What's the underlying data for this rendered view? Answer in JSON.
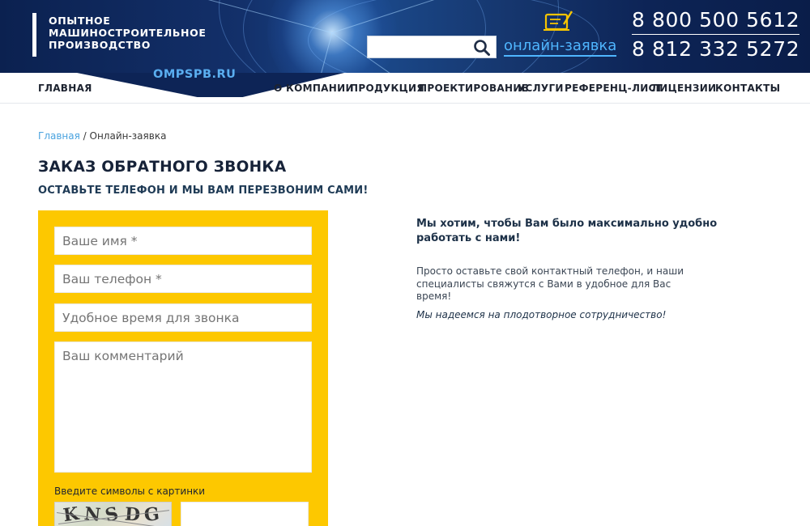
{
  "header": {
    "logo_lines": [
      "ОПЫТНОЕ",
      "МАШИНОСТРОИТЕЛЬНОЕ",
      "ПРОИЗВОДСТВО"
    ],
    "site_url": "OMPSPB.RU",
    "search": {
      "placeholder": "",
      "value": ""
    },
    "order_link": "онлайн-заявка",
    "phones": [
      "8 800 500 5612",
      "8 812 332 5272"
    ],
    "colors": {
      "bg": "#0d2456",
      "accent": "#4fb6ff"
    }
  },
  "nav": {
    "items": [
      "ГЛАВНАЯ",
      "О КОМПАНИИ",
      "ПРОДУКЦИЯ",
      "ПРОЕКТИРОВАНИЕ",
      "УСЛУГИ",
      "РЕФЕРЕНЦ-ЛИСТ",
      "ЛИЦЕНЗИИ",
      "КОНТАКТЫ"
    ]
  },
  "breadcrumb": {
    "home": "Главная",
    "separator": " / ",
    "current": "Онлайн-заявка"
  },
  "page": {
    "title": "ЗАКАЗ ОБРАТНОГО ЗВОНКА",
    "subtitle": "ОСТАВЬТЕ ТЕЛЕФОН И МЫ ВАМ ПЕРЕЗВОНИМ САМИ!"
  },
  "form": {
    "name_placeholder": "Ваше имя *",
    "phone_placeholder": "Ваш телефон *",
    "time_placeholder": "Удобное время для звонка",
    "comment_placeholder": "Ваш комментарий",
    "captcha_label": "Введите символы с картинки",
    "captcha_chars": [
      "K",
      "N",
      "S",
      "D",
      "G"
    ],
    "captcha_value": "",
    "box_color": "#fdc800"
  },
  "info": {
    "title": "Мы хотим, чтобы Вам было максимально удобно работать с нами!",
    "text": "Просто оставьте свой контактный телефон, и наши специалисты свяжутся с Вами в удобное для Вас время!",
    "note": "Мы надеемся на плодотворное сотрудничество!"
  }
}
